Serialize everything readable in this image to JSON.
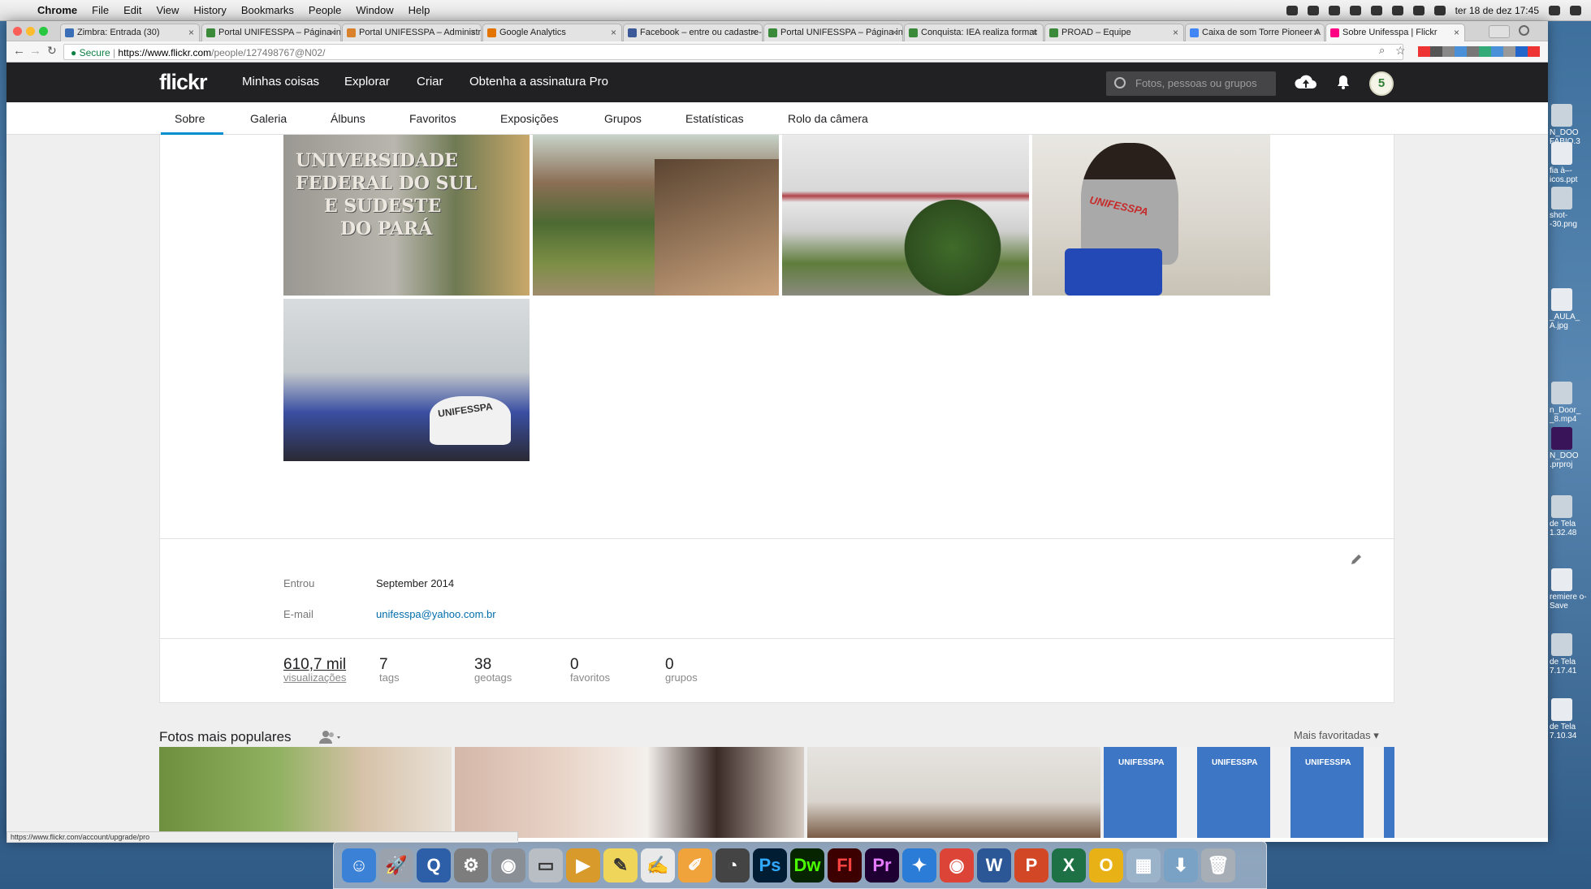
{
  "menubar": {
    "app": "Chrome",
    "items": [
      "File",
      "Edit",
      "View",
      "History",
      "Bookmarks",
      "People",
      "Window",
      "Help"
    ],
    "clock": "ter 18 de dez  17:45"
  },
  "tabs": [
    {
      "title": "Zimbra: Entrada (30)",
      "color": "#3a6fb7"
    },
    {
      "title": "Portal UNIFESSPA – Página ini",
      "color": "#3a8a3a"
    },
    {
      "title": "Portal UNIFESSPA – Administr",
      "color": "#d9822b"
    },
    {
      "title": "Google Analytics",
      "color": "#e37400"
    },
    {
      "title": "Facebook – entre ou cadastre-",
      "color": "#3b5998"
    },
    {
      "title": "Portal UNIFESSPA – Página ini",
      "color": "#3a8a3a"
    },
    {
      "title": "Conquista: IEA realiza format",
      "color": "#3a8a3a"
    },
    {
      "title": "PROAD – Equipe",
      "color": "#3a8a3a"
    },
    {
      "title": "Caixa de som Torre Pioneer A",
      "color": "#4285f4"
    },
    {
      "title": "Sobre Unifesspa | Flickr",
      "color": "#ff0084"
    }
  ],
  "address": {
    "secure": "Secure",
    "domain": "https://www.flickr.com",
    "path": "/people/127498767@N02/"
  },
  "flickr": {
    "logo": "flickr",
    "menu": [
      "Minhas coisas",
      "Explorar",
      "Criar",
      "Obtenha a assinatura Pro"
    ],
    "search_placeholder": "Fotos, pessoas ou grupos",
    "avatar_initial": "5"
  },
  "subnav": [
    "Sobre",
    "Galeria",
    "Álbuns",
    "Favoritos",
    "Exposições",
    "Grupos",
    "Estatísticas",
    "Rolo da câmera"
  ],
  "info": {
    "joined_label": "Entrou",
    "joined_value": "September 2014",
    "email_label": "E-mail",
    "email_value": "unifesspa@yahoo.com.br"
  },
  "stats": [
    {
      "num": "610,7 mil",
      "label": "visualizações"
    },
    {
      "num": "7",
      "label": "tags"
    },
    {
      "num": "38",
      "label": "geotags"
    },
    {
      "num": "0",
      "label": "favoritos"
    },
    {
      "num": "0",
      "label": "grupos"
    }
  ],
  "photo_texts": {
    "sign": [
      "UNIVERSIDADE",
      "FEDERAL DO SUL",
      "E SUDESTE",
      "DO PARÁ"
    ],
    "shirt": "UNIFESSPA",
    "banner": "UNIFESSPA"
  },
  "popular": {
    "title": "Fotos mais populares",
    "sort": "Mais favoritadas"
  },
  "status_url": "https://www.flickr.com/account/upgrade/pro",
  "desktop_items": [
    "N_DOO FABIO.3",
    "fia à–- icos.ppt",
    "shot- -30.png",
    "_AULA_ A.jpg",
    "n_Door_ _8.mp4",
    "N_DOO .prproj",
    "de Tela 1.32.48",
    "remiere o-Save",
    "de Tela 7.17.41",
    "de Tela 7.10.34"
  ],
  "dock_apps": [
    {
      "name": "finder",
      "label": "☺",
      "color": "#3b82d6"
    },
    {
      "name": "launchpad",
      "label": "🚀",
      "color": "#9aa3ad"
    },
    {
      "name": "quicktime",
      "label": "Q",
      "color": "#2c5fa8"
    },
    {
      "name": "system-preferences",
      "label": "⚙",
      "color": "#7d7d7d"
    },
    {
      "name": "disk-utility",
      "label": "◉",
      "color": "#8a8f96"
    },
    {
      "name": "scanner",
      "label": "▭",
      "color": "#b9bec4"
    },
    {
      "name": "transmit",
      "label": "▶",
      "color": "#d79a2b"
    },
    {
      "name": "stickies",
      "label": "✎",
      "color": "#efd65b"
    },
    {
      "name": "textedit",
      "label": "✍",
      "color": "#e9e9e9"
    },
    {
      "name": "pages",
      "label": "✐",
      "color": "#f0a33b"
    },
    {
      "name": "time-machine",
      "label": "◔",
      "color": "#444"
    },
    {
      "name": "photoshop",
      "label": "Ps",
      "color": "#001d34"
    },
    {
      "name": "dreamweaver",
      "label": "Dw",
      "color": "#072401"
    },
    {
      "name": "flash",
      "label": "Fl",
      "color": "#3d0000"
    },
    {
      "name": "premiere",
      "label": "Pr",
      "color": "#1f0033"
    },
    {
      "name": "safari",
      "label": "✦",
      "color": "#2b7cd6"
    },
    {
      "name": "chrome",
      "label": "◉",
      "color": "#db4437"
    },
    {
      "name": "word",
      "label": "W",
      "color": "#2b5797"
    },
    {
      "name": "powerpoint",
      "label": "P",
      "color": "#d24726"
    },
    {
      "name": "excel",
      "label": "X",
      "color": "#1e7145"
    },
    {
      "name": "outlook",
      "label": "O",
      "color": "#e8b217"
    },
    {
      "name": "preview",
      "label": "▦",
      "color": "#9bb3c9"
    },
    {
      "name": "downloads",
      "label": "⬇",
      "color": "#7aa2c4"
    },
    {
      "name": "trash",
      "label": "🗑",
      "color": "#a7aeb5"
    }
  ]
}
